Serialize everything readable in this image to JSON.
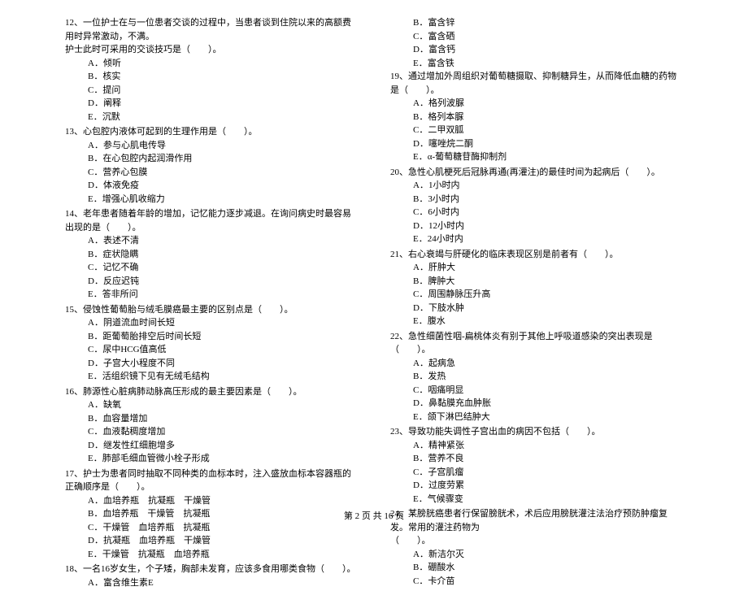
{
  "left_column": [
    {
      "num": "12",
      "text": "、一位护士在与一位患者交谈的过程中，当患者谈到住院以来的高额费用时异常激动，不满。",
      "continue": "护士此时可采用的交谈技巧是（　　）。",
      "options": [
        "A．倾听",
        "B．核实",
        "C．提问",
        "D．阐释",
        "E．沉默"
      ]
    },
    {
      "num": "13",
      "text": "、心包腔内液体可起到的生理作用是（　　）。",
      "options": [
        "A．参与心肌电传导",
        "B．在心包腔内起润滑作用",
        "C．营养心包膜",
        "D．体液免疫",
        "E．增强心肌收缩力"
      ]
    },
    {
      "num": "14",
      "text": "、老年患者随着年龄的增加，记忆能力逐步减退。在询问病史时最容易出现的是（　　）。",
      "options": [
        "A．表述不清",
        "B．症状隐瞒",
        "C．记忆不确",
        "D．反应迟钝",
        "E．答非所问"
      ]
    },
    {
      "num": "15",
      "text": "、侵蚀性葡萄胎与绒毛膜癌最主要的区别点是（　　）。",
      "options": [
        "A．阴道流血时间长短",
        "B．距葡萄胎排空后时间长短",
        "C．尿中HCG值高低",
        "D．子宫大小程度不同",
        "E．活组织镜下见有无绒毛结构"
      ]
    },
    {
      "num": "16",
      "text": "、肺源性心脏病肺动脉高压形成的最主要因素是（　　）。",
      "options": [
        "A．缺氧",
        "B．血容量增加",
        "C．血液黏稠度增加",
        "D．继发性红细胞增多",
        "E．肺部毛细血管微小栓子形成"
      ]
    },
    {
      "num": "17",
      "text": "、护士为患者同时抽取不同种类的血标本时，注入盛放血标本容器瓶的正确顺序是（　　）。",
      "options": [
        "A．血培养瓶　抗凝瓶　干燥管",
        "B．血培养瓶　干燥管　抗凝瓶",
        "C．干燥管　血培养瓶　抗凝瓶",
        "D．抗凝瓶　血培养瓶　干燥管",
        "E．干燥管　抗凝瓶　血培养瓶"
      ]
    },
    {
      "num": "18",
      "text": "、一名16岁女生，个子矮，胸部未发育，应该多食用哪类食物（　　）。",
      "options": [
        "A．富含维生素E"
      ]
    }
  ],
  "right_column_prefix_options": [
    "B．富含锌",
    "C．富含硒",
    "D．富含钙",
    "E．富含铁"
  ],
  "right_column": [
    {
      "num": "19",
      "text": "、通过增加外周组织对葡萄糖摄取、抑制糖异生，从而降低血糖的药物是（　　）。",
      "options": [
        "A．格列波脲",
        "B．格列本脲",
        "C．二甲双胍",
        "D．噻唑烷二酮",
        "E．α-葡萄糖苷酶抑制剂"
      ]
    },
    {
      "num": "20",
      "text": "、急性心肌梗死后冠脉再通(再灌注)的最佳时间为起病后（　　）。",
      "options": [
        "A．1小时内",
        "B．3小时内",
        "C．6小时内",
        "D．12小时内",
        "E．24小时内"
      ]
    },
    {
      "num": "21",
      "text": "、右心衰竭与肝硬化的临床表现区别是前者有（　　）。",
      "options": [
        "A．肝肿大",
        "B．脾肿大",
        "C．周围静脉压升高",
        "D．下肢水肿",
        "E．腹水"
      ]
    },
    {
      "num": "22",
      "text": "、急性细菌性咽-扁桃体炎有别于其他上呼吸道感染的突出表现是（　　）。",
      "options": [
        "A．起病急",
        "B．发热",
        "C．咽痛明显",
        "D．鼻黏膜充血肿胀",
        "E．颌下淋巴结肿大"
      ]
    },
    {
      "num": "23",
      "text": "、导致功能失调性子宫出血的病因不包括（　　）。",
      "options": [
        "A．精神紧张",
        "B．营养不良",
        "C．子宫肌瘤",
        "D．过度劳累",
        "E．气候骤变"
      ]
    },
    {
      "num": "24",
      "text": "、某膀胱癌患者行保留膀胱术，术后应用膀胱灌注法治疗预防肿瘤复发。常用的灌注药物为",
      "continue": "（　　）。",
      "options": [
        "A．新洁尔灭",
        "B．硼酸水",
        "C．卡介苗"
      ]
    }
  ],
  "footer": "第 2 页 共 16 页"
}
